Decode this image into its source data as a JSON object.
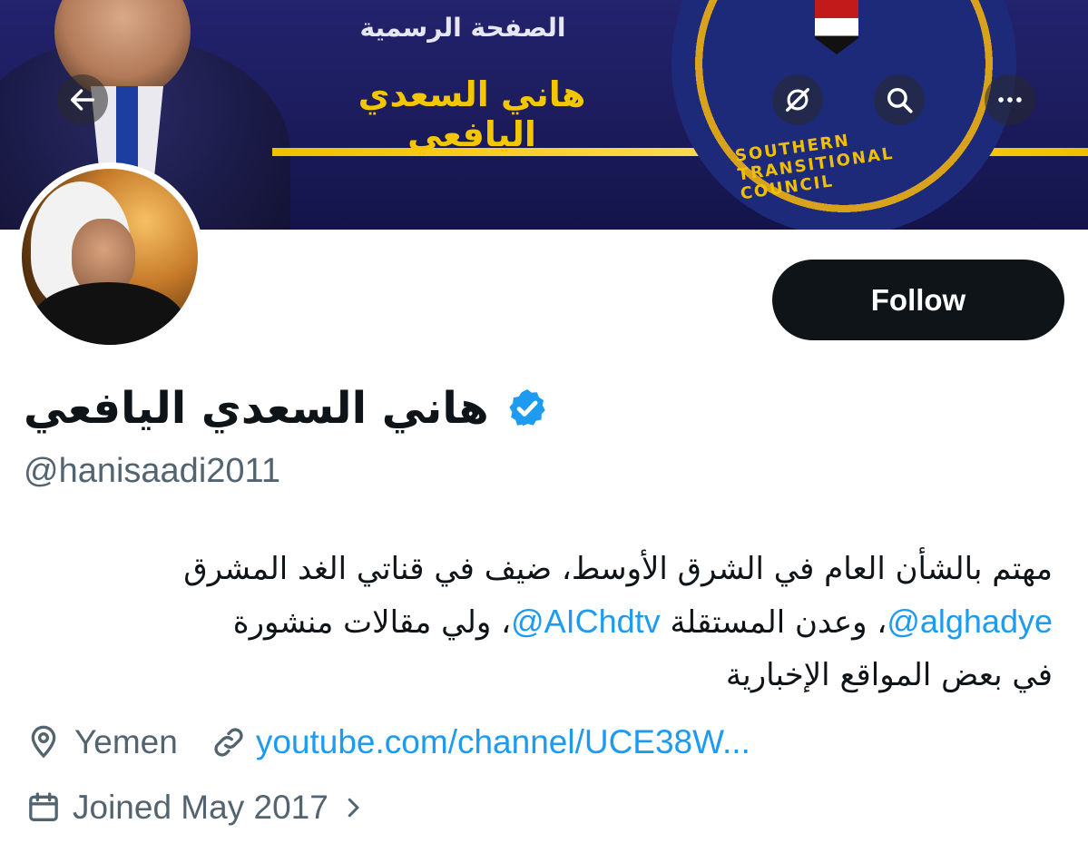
{
  "banner": {
    "subtitle": "الصفحة الرسمية",
    "title": "هاني السعدي اليافعي",
    "seal_text": "SOUTHERN TRANSITIONAL COUNCIL"
  },
  "nav": {
    "back_icon": "arrow-left-icon",
    "grok_icon": "grok-icon",
    "search_icon": "search-icon",
    "more_icon": "more-dots-icon"
  },
  "profile": {
    "display_name": "هاني السعدي اليافعي",
    "handle": "@hanisaadi2011",
    "follow_label": "Follow",
    "verified_color": "#1d9bf0",
    "bio": {
      "line1": "مهتم بالشأن العام في الشرق الأوسط، ضيف في قناتي الغد المشرق",
      "mention1": "@alghadye",
      "text2": "، وعدن المستقلة ",
      "mention2": "@AIChdtv",
      "text3": "، ولي مقالات منشورة",
      "line3": "في بعض المواقع الإخبارية"
    },
    "location": "Yemen",
    "website": "youtube.com/channel/UCE38W...",
    "joined": "Joined May 2017"
  },
  "colors": {
    "accent": "#1d9bf0",
    "text_secondary": "#536471",
    "button_bg": "#0f1419"
  }
}
